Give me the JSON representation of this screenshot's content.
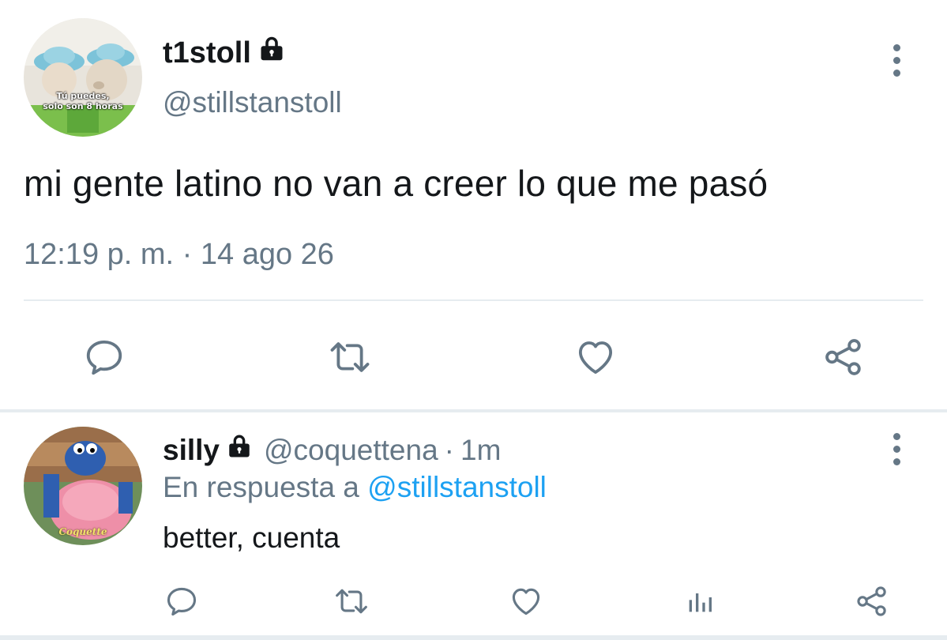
{
  "main_tweet": {
    "avatar_caption": [
      "Tú puedes,",
      "solo son 8 horas"
    ],
    "display_name": "t1stoll",
    "handle": "@stillstanstoll",
    "text": "mi gente latino no van a creer lo que me pasó",
    "timestamp": "12:19 p. m. · 14 ago 26",
    "actions": [
      "reply-icon",
      "retweet-icon",
      "like-icon",
      "share-icon"
    ]
  },
  "reply": {
    "avatar_caption": "Coquette",
    "display_name": "silly",
    "handle": "@coquettena",
    "separator": "·",
    "time": "1m",
    "in_reply_to_prefix": "En respuesta a",
    "in_reply_to_handle": "@stillstanstoll",
    "text": "better, cuenta",
    "actions": [
      "reply-icon",
      "retweet-icon",
      "like-icon",
      "analytics-icon",
      "share-icon"
    ]
  },
  "colors": {
    "text_primary": "#14171a",
    "text_secondary": "#657786",
    "link": "#1da1f2",
    "divider": "#e6ecf0"
  }
}
